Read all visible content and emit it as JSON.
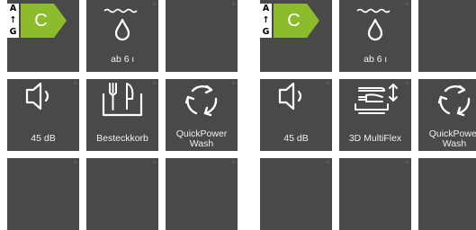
{
  "colors": {
    "tile": "#494949",
    "energy_arrow": "#8cbb2b",
    "icon": "#ffffff",
    "text": "#f0f0f0"
  },
  "products": [
    {
      "energy": {
        "scale_top": "A",
        "scale_arrow": "↑",
        "scale_bottom": "G",
        "class": "C"
      },
      "water": "ab 6 ι",
      "noise": "45 dB",
      "basket": "Besteckkorb",
      "wash_line1": "QuickPower",
      "wash_line2": "Wash"
    },
    {
      "energy": {
        "scale_top": "A",
        "scale_arrow": "↑",
        "scale_bottom": "G",
        "class": "C"
      },
      "water": "ab 6 ι",
      "noise": "45 dB",
      "basket": "3D MultiFlex",
      "wash_line1": "QuickPower",
      "wash_line2": "Wash"
    }
  ]
}
